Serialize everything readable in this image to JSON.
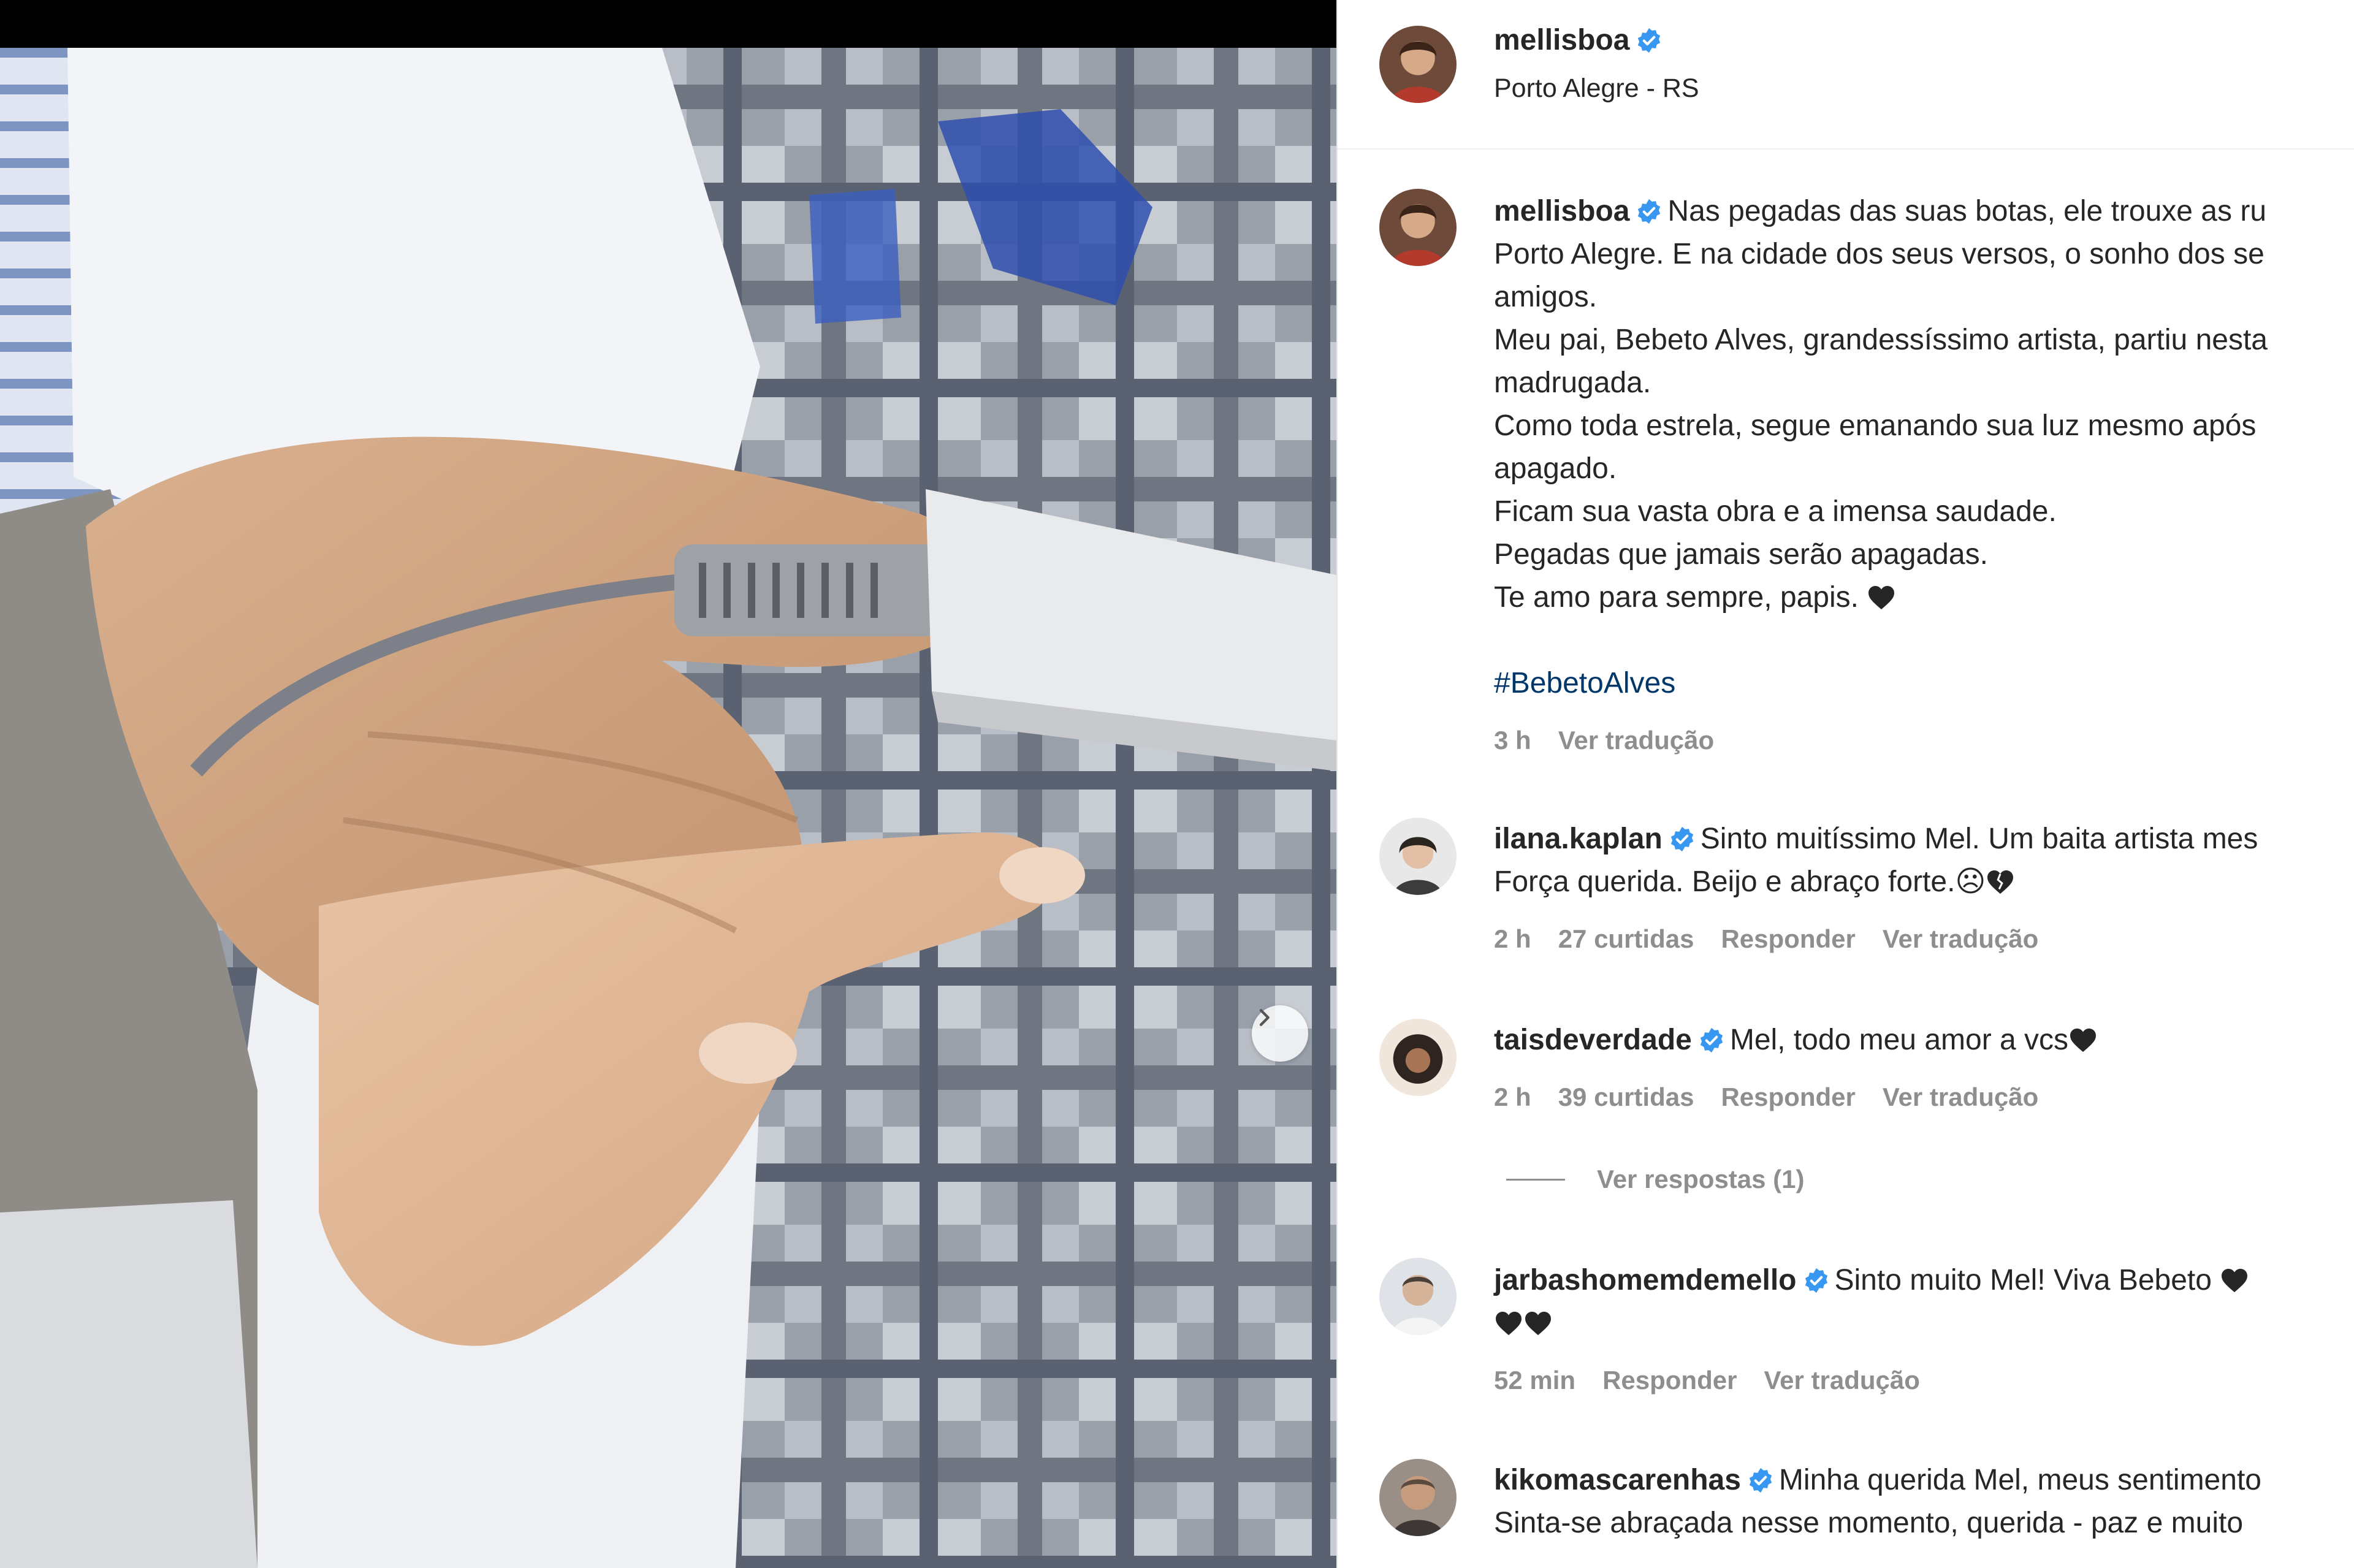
{
  "post": {
    "author": "mellisboa",
    "location": "Porto Alegre - RS",
    "caption": {
      "author": "mellisboa",
      "lines": [
        "Nas pegadas das suas botas, ele trouxe as ru",
        "Porto Alegre. E na cidade dos seus versos, o sonho dos se",
        "amigos.",
        "Meu pai, Bebeto Alves, grandessíssimo artista, partiu nesta",
        "madrugada.",
        "Como toda estrela, segue emanando sua luz mesmo após",
        "apagado.",
        "Ficam sua vasta obra e a imensa saudade.",
        "Pegadas que jamais serão apagadas.",
        "Te amo para sempre, papis."
      ],
      "hashtag": "#BebetoAlves",
      "time": "3 h",
      "translate": "Ver tradução"
    }
  },
  "comments": [
    {
      "author": "ilana.kaplan",
      "lines": [
        "Sinto muitíssimo Mel. Um baita artista mes",
        "Força querida. Beijo e abraço forte.☹"
      ],
      "time": "2 h",
      "likes": "27 curtidas",
      "reply": "Responder",
      "translate": "Ver tradução"
    },
    {
      "author": "taisdeverdade",
      "lines": [
        "Mel, todo meu amor a vcs"
      ],
      "time": "2 h",
      "likes": "39 curtidas",
      "reply": "Responder",
      "translate": "Ver tradução",
      "view_replies": "Ver respostas (1)"
    },
    {
      "author": "jarbashomemdemello",
      "lines": [
        "Sinto muito Mel! Viva Bebeto",
        ""
      ],
      "time": "52 min",
      "reply": "Responder",
      "translate": "Ver tradução"
    },
    {
      "author": "kikomascarenhas",
      "lines": [
        "Minha querida Mel, meus sentimento",
        "Sinta-se abraçada nesse momento, querida - paz e muito"
      ]
    }
  ],
  "colors": {
    "verified": "#3897f0",
    "hashtag": "#00376b",
    "muted": "#8e8e8e",
    "text": "#262626"
  },
  "icons": [
    "verified-badge-icon",
    "heart-icon",
    "broken-heart-icon",
    "chevron-right-icon"
  ]
}
